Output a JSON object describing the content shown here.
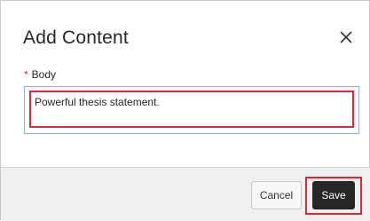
{
  "dialog": {
    "title": "Add Content",
    "close_icon": "close-icon"
  },
  "body_field": {
    "required_marker": "*",
    "label": "Body",
    "value": "Powerful thesis statement."
  },
  "footer": {
    "cancel_label": "Cancel",
    "save_label": "Save"
  },
  "colors": {
    "highlight": "#e0263a",
    "primary_button": "#262626",
    "footer_bg": "#f0f0f0"
  }
}
